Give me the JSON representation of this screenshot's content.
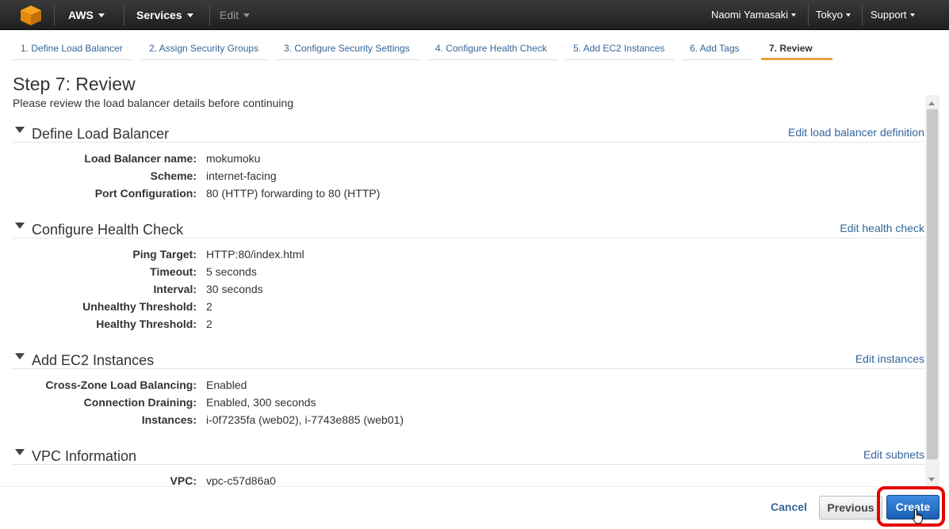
{
  "topnav": {
    "brand": "AWS",
    "services": "Services",
    "edit": "Edit",
    "user": "Naomi Yamasaki",
    "region": "Tokyo",
    "support": "Support"
  },
  "wizard": {
    "tabs": [
      {
        "label": "1. Define Load Balancer"
      },
      {
        "label": "2. Assign Security Groups"
      },
      {
        "label": "3. Configure Security Settings"
      },
      {
        "label": "4. Configure Health Check"
      },
      {
        "label": "5. Add EC2 Instances"
      },
      {
        "label": "6. Add Tags"
      },
      {
        "label": "7. Review"
      }
    ]
  },
  "header": {
    "title": "Step 7: Review",
    "subtitle": "Please review the load balancer details before continuing"
  },
  "sections": [
    {
      "title": "Define Load Balancer",
      "edit": "Edit load balancer definition",
      "rows": [
        {
          "label": "Load Balancer name:",
          "value": "mokumoku"
        },
        {
          "label": "Scheme:",
          "value": "internet-facing"
        },
        {
          "label": "Port Configuration:",
          "value": "80 (HTTP) forwarding to 80 (HTTP)"
        }
      ]
    },
    {
      "title": "Configure Health Check",
      "edit": "Edit health check",
      "rows": [
        {
          "label": "Ping Target:",
          "value": "HTTP:80/index.html"
        },
        {
          "label": "Timeout:",
          "value": "5 seconds"
        },
        {
          "label": "Interval:",
          "value": "30 seconds"
        },
        {
          "label": "Unhealthy Threshold:",
          "value": "2"
        },
        {
          "label": "Healthy Threshold:",
          "value": "2"
        }
      ]
    },
    {
      "title": "Add EC2 Instances",
      "edit": "Edit instances",
      "rows": [
        {
          "label": "Cross-Zone Load Balancing:",
          "value": "Enabled"
        },
        {
          "label": "Connection Draining:",
          "value": "Enabled, 300 seconds"
        },
        {
          "label": "Instances:",
          "value": "i-0f7235fa (web02), i-7743e885 (web01)"
        }
      ]
    },
    {
      "title": "VPC Information",
      "edit": "Edit subnets",
      "rows": [
        {
          "label": "VPC:",
          "value": "vpc-c57d86a0"
        }
      ]
    }
  ],
  "footer": {
    "cancel": "Cancel",
    "previous": "Previous",
    "create": "Create"
  },
  "colors": {
    "link": "#336699",
    "active_tab_underline": "#e9a23b",
    "primary_button": "#1a5fb4",
    "highlight": "#e60000"
  }
}
